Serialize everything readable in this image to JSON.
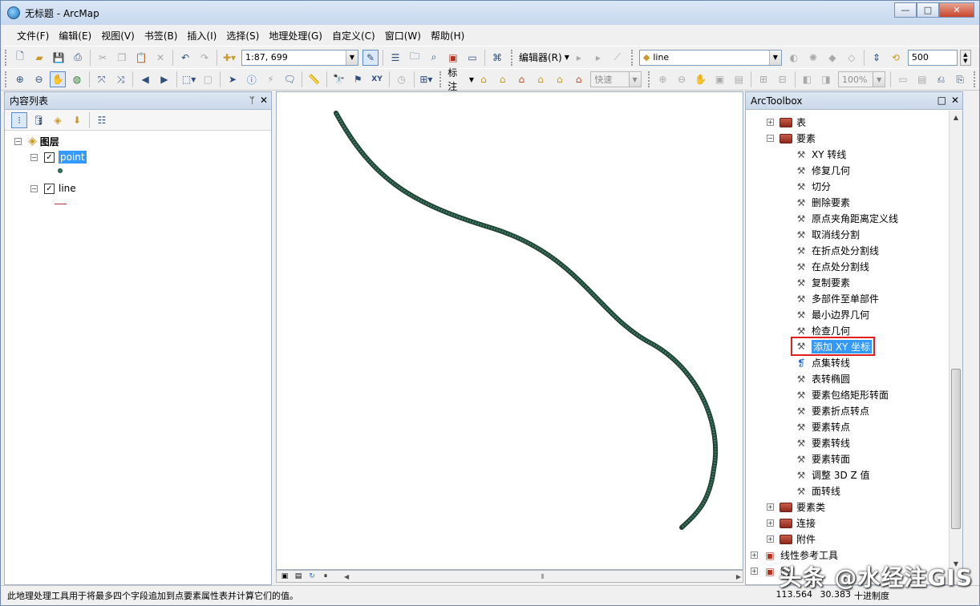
{
  "window": {
    "title": "无标题 - ArcMap",
    "controls": {
      "minimize": "—",
      "maximize": "□",
      "close": "✕"
    }
  },
  "menu": [
    "文件(F)",
    "编辑(E)",
    "视图(V)",
    "书签(B)",
    "插入(I)",
    "选择(S)",
    "地理处理(G)",
    "自定义(C)",
    "窗口(W)",
    "帮助(H)"
  ],
  "toolbar1": {
    "scale": "1:87, 699",
    "editor_label": "编辑器(R)",
    "layer_value": "line",
    "snap_value": "500"
  },
  "toolbar2": {
    "label_text": "标注",
    "label_speed": "快速",
    "zoom_percent": "100%"
  },
  "toc": {
    "title": "内容列表",
    "pin": "ᛘ",
    "close": "✕",
    "root_label": "图层",
    "layers": [
      {
        "name": "point",
        "checked": "✓",
        "symbol": "point-symbol"
      },
      {
        "name": "line",
        "checked": "✓",
        "symbol": "line-symbol"
      }
    ]
  },
  "toolbox": {
    "title": "ArcToolbox",
    "items": [
      {
        "label": "表",
        "type": "toolset",
        "expander": "+"
      },
      {
        "label": "要素",
        "type": "toolset",
        "expander": "−"
      },
      {
        "label": "XY 转线",
        "type": "tool"
      },
      {
        "label": "修复几何",
        "type": "tool"
      },
      {
        "label": "切分",
        "type": "tool"
      },
      {
        "label": "删除要素",
        "type": "tool"
      },
      {
        "label": "原点夹角距离定义线",
        "type": "tool"
      },
      {
        "label": "取消线分割",
        "type": "tool"
      },
      {
        "label": "在折点处分割线",
        "type": "tool"
      },
      {
        "label": "在点处分割线",
        "type": "tool"
      },
      {
        "label": "复制要素",
        "type": "tool"
      },
      {
        "label": "多部件至单部件",
        "type": "tool"
      },
      {
        "label": "最小边界几何",
        "type": "tool"
      },
      {
        "label": "检查几何",
        "type": "tool"
      },
      {
        "label": "添加 XY 坐标",
        "type": "tool",
        "selected": true
      },
      {
        "label": "点集转线",
        "type": "script"
      },
      {
        "label": "表转椭圆",
        "type": "tool"
      },
      {
        "label": "要素包络矩形转面",
        "type": "tool"
      },
      {
        "label": "要素折点转点",
        "type": "tool"
      },
      {
        "label": "要素转点",
        "type": "tool"
      },
      {
        "label": "要素转线",
        "type": "tool"
      },
      {
        "label": "要素转面",
        "type": "tool"
      },
      {
        "label": "调整 3D Z 值",
        "type": "tool"
      },
      {
        "label": "面转线",
        "type": "tool"
      },
      {
        "label": "要素类",
        "type": "toolset",
        "expander": "+"
      },
      {
        "label": "连接",
        "type": "toolset",
        "expander": "+"
      },
      {
        "label": "附件",
        "type": "toolset",
        "expander": "+"
      },
      {
        "label": "线性参考工具",
        "type": "toolbox",
        "expander": "+"
      },
      {
        "label": "制",
        "type": "toolbox",
        "expander": "+"
      }
    ]
  },
  "status": {
    "message": "此地理处理工具用于将最多四个字段追加到点要素属性表并计算它们的值。",
    "x": "113.564",
    "y": "30.383",
    "units": "十进制度"
  },
  "watermark": "头条 @水经注GIS",
  "colors": {
    "line_feature": "#2f5a4a",
    "selection": "#3399ff",
    "highlight_border": "#e02020"
  }
}
